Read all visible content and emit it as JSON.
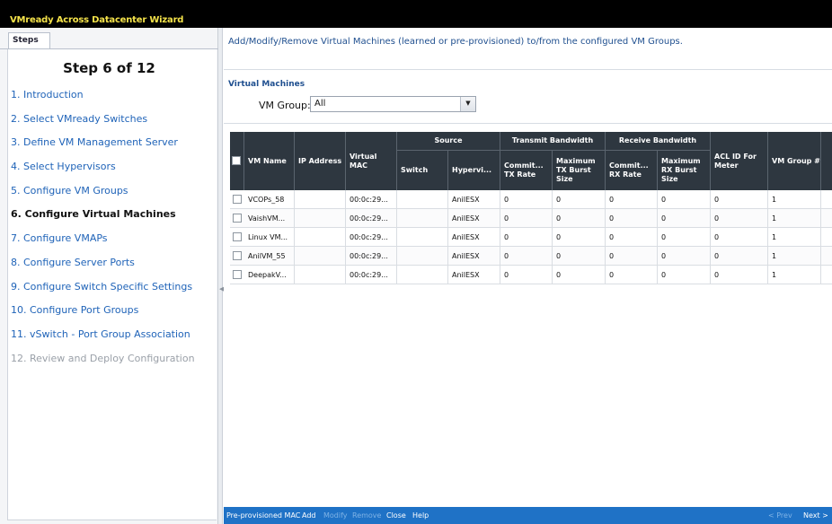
{
  "window": {
    "title": "VMready Across Datacenter Wizard"
  },
  "steps_panel": {
    "tab_label": "Steps",
    "header": "Step 6 of 12",
    "items": [
      {
        "label": "1. Introduction",
        "state": "link"
      },
      {
        "label": "2. Select VMready Switches",
        "state": "link"
      },
      {
        "label": "3. Define VM Management Server",
        "state": "link"
      },
      {
        "label": "4. Select Hypervisors",
        "state": "link"
      },
      {
        "label": "5. Configure VM Groups",
        "state": "link"
      },
      {
        "label": "6. Configure Virtual Machines",
        "state": "current"
      },
      {
        "label": "7. Configure VMAPs",
        "state": "link"
      },
      {
        "label": "8. Configure Server Ports",
        "state": "link"
      },
      {
        "label": "9. Configure Switch Specific Settings",
        "state": "link"
      },
      {
        "label": "10. Configure Port Groups",
        "state": "link"
      },
      {
        "label": "11. vSwitch - Port Group Association",
        "state": "link"
      },
      {
        "label": "12. Review and Deploy Configuration",
        "state": "disabled"
      }
    ]
  },
  "main": {
    "instruction": "Add/Modify/Remove Virtual Machines (learned or pre-provisioned) to/from the configured VM Groups.",
    "section_title": "Virtual Machines",
    "vm_group": {
      "label": "VM Group:",
      "value": "All"
    },
    "table": {
      "group_headers": [
        "Source",
        "Transmit Bandwidth",
        "Receive Bandwidth"
      ],
      "columns": [
        "VM Name",
        "IP Address",
        "Virtual MAC",
        "Switch",
        "Hypervi...",
        "Commit... TX Rate",
        "Maximum TX Burst Size",
        "Commit... RX Rate",
        "Maximum RX Burst Size",
        "ACL ID For Meter",
        "VM Group #"
      ],
      "rows": [
        [
          "VCOPs_58",
          "",
          "00:0c:29...",
          "",
          "AnilESX",
          "0",
          "0",
          "0",
          "0",
          "0",
          "1"
        ],
        [
          "VaishVM...",
          "",
          "00:0c:29...",
          "",
          "AnilESX",
          "0",
          "0",
          "0",
          "0",
          "0",
          "1"
        ],
        [
          "Linux VM...",
          "",
          "00:0c:29...",
          "",
          "AnilESX",
          "0",
          "0",
          "0",
          "0",
          "0",
          "1"
        ],
        [
          "AnilVM_55",
          "",
          "00:0c:29...",
          "",
          "AnilESX",
          "0",
          "0",
          "0",
          "0",
          "0",
          "1"
        ],
        [
          "DeepakV...",
          "",
          "00:0c:29...",
          "",
          "AnilESX",
          "0",
          "0",
          "0",
          "0",
          "0",
          "1"
        ]
      ]
    }
  },
  "bottom_bar": {
    "left_actions": [
      {
        "label": "Pre-provisioned MAC",
        "enabled": true
      },
      {
        "label": "Add",
        "enabled": true
      },
      {
        "label": "Modify",
        "enabled": false
      },
      {
        "label": "Remove",
        "enabled": false
      },
      {
        "label": "Close",
        "enabled": true
      },
      {
        "label": "Help",
        "enabled": true
      }
    ],
    "prev_label": "< Prev",
    "next_label": "Next >"
  },
  "colors": {
    "title_text": "#f5e34a",
    "link": "#1f63b8",
    "grid_header": "#2e3740",
    "bottom_bar": "#1f72c6"
  }
}
